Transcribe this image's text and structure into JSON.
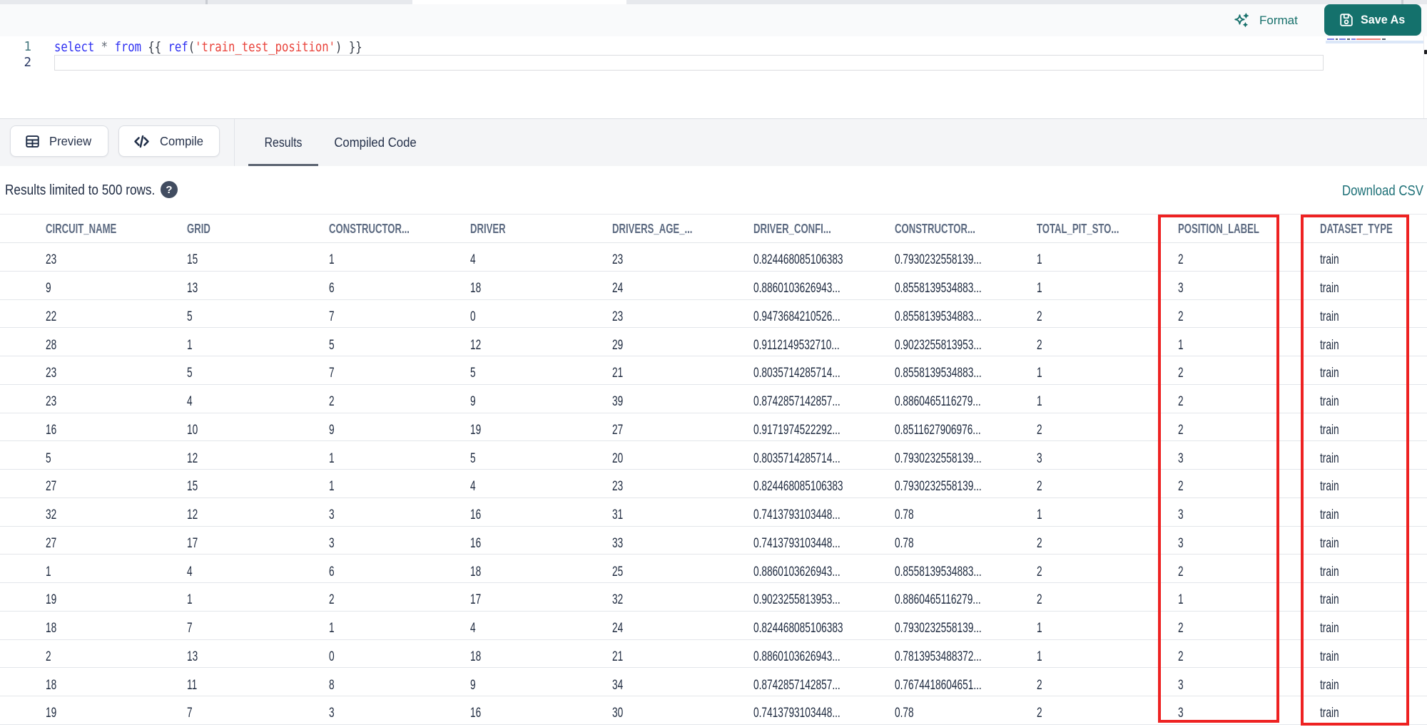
{
  "editor_header": {
    "format_label": "Format",
    "save_as_label": "Save As"
  },
  "editor": {
    "lines": [
      {
        "number": "1",
        "tokens": [
          {
            "t": "select",
            "c": "kw"
          },
          {
            "t": " "
          },
          {
            "t": "*",
            "c": "op"
          },
          {
            "t": " "
          },
          {
            "t": "from",
            "c": "kw"
          },
          {
            "t": " "
          },
          {
            "t": "{{",
            "c": "br"
          },
          {
            "t": " "
          },
          {
            "t": "ref",
            "c": "fn"
          },
          {
            "t": "(",
            "c": "br"
          },
          {
            "t": "'train_test_position'",
            "c": "str"
          },
          {
            "t": ")",
            "c": "br"
          },
          {
            "t": " "
          },
          {
            "t": "}}",
            "c": "br"
          }
        ],
        "text": "select * from {{ ref('train_test_position') }}"
      },
      {
        "number": "2",
        "tokens": [],
        "text": ""
      }
    ]
  },
  "panel": {
    "preview_label": "Preview",
    "compile_label": "Compile",
    "tabs": [
      {
        "label": "Results",
        "active": true
      },
      {
        "label": "Compiled Code",
        "active": false
      }
    ]
  },
  "results": {
    "limit_note": "Results limited to 500 rows.",
    "help_glyph": "?",
    "download_label": "Download CSV"
  },
  "table": {
    "headers": [
      "CIRCUIT_NAME",
      "GRID",
      "CONSTRUCTOR...",
      "DRIVER",
      "DRIVERS_AGE_...",
      "DRIVER_CONFI...",
      "CONSTRUCTOR...",
      "TOTAL_PIT_STO...",
      "POSITION_LABEL",
      "DATASET_TYPE"
    ],
    "rows": [
      [
        "23",
        "15",
        "1",
        "4",
        "23",
        "0.824468085106383",
        "0.7930232558139...",
        "1",
        "2",
        "train"
      ],
      [
        "9",
        "13",
        "6",
        "18",
        "24",
        "0.8860103626943...",
        "0.8558139534883...",
        "1",
        "3",
        "train"
      ],
      [
        "22",
        "5",
        "7",
        "0",
        "23",
        "0.9473684210526...",
        "0.8558139534883...",
        "2",
        "2",
        "train"
      ],
      [
        "28",
        "1",
        "5",
        "12",
        "29",
        "0.9112149532710...",
        "0.9023255813953...",
        "2",
        "1",
        "train"
      ],
      [
        "23",
        "5",
        "7",
        "5",
        "21",
        "0.8035714285714...",
        "0.8558139534883...",
        "1",
        "2",
        "train"
      ],
      [
        "23",
        "4",
        "2",
        "9",
        "39",
        "0.8742857142857...",
        "0.8860465116279...",
        "1",
        "2",
        "train"
      ],
      [
        "16",
        "10",
        "9",
        "19",
        "27",
        "0.9171974522292...",
        "0.8511627906976...",
        "2",
        "2",
        "train"
      ],
      [
        "5",
        "12",
        "1",
        "5",
        "20",
        "0.8035714285714...",
        "0.7930232558139...",
        "3",
        "3",
        "train"
      ],
      [
        "27",
        "15",
        "1",
        "4",
        "23",
        "0.824468085106383",
        "0.7930232558139...",
        "2",
        "2",
        "train"
      ],
      [
        "32",
        "12",
        "3",
        "16",
        "31",
        "0.7413793103448...",
        "0.78",
        "1",
        "3",
        "train"
      ],
      [
        "27",
        "17",
        "3",
        "16",
        "33",
        "0.7413793103448...",
        "0.78",
        "2",
        "3",
        "train"
      ],
      [
        "1",
        "4",
        "6",
        "18",
        "25",
        "0.8860103626943...",
        "0.8558139534883...",
        "2",
        "2",
        "train"
      ],
      [
        "19",
        "1",
        "2",
        "17",
        "32",
        "0.9023255813953...",
        "0.8860465116279...",
        "2",
        "1",
        "train"
      ],
      [
        "18",
        "7",
        "1",
        "4",
        "24",
        "0.824468085106383",
        "0.7930232558139...",
        "1",
        "2",
        "train"
      ],
      [
        "2",
        "13",
        "0",
        "18",
        "21",
        "0.8860103626943...",
        "0.7813953488372...",
        "1",
        "2",
        "train"
      ],
      [
        "18",
        "11",
        "8",
        "9",
        "34",
        "0.8742857142857...",
        "0.7674418604651...",
        "2",
        "3",
        "train"
      ],
      [
        "19",
        "7",
        "3",
        "16",
        "30",
        "0.7413793103448...",
        "0.78",
        "2",
        "3",
        "train"
      ]
    ]
  },
  "annotations": {
    "highlighted_columns": [
      "POSITION_LABEL",
      "DATASET_TYPE"
    ],
    "box_color": "#ee2222"
  },
  "colors": {
    "accent_teal": "#14716c",
    "link_teal": "#1d7077",
    "code_keyword": "#2d2ff2",
    "code_string": "#e9423a",
    "header_text": "#5c6a81",
    "cell_text": "#1e2a3f"
  }
}
